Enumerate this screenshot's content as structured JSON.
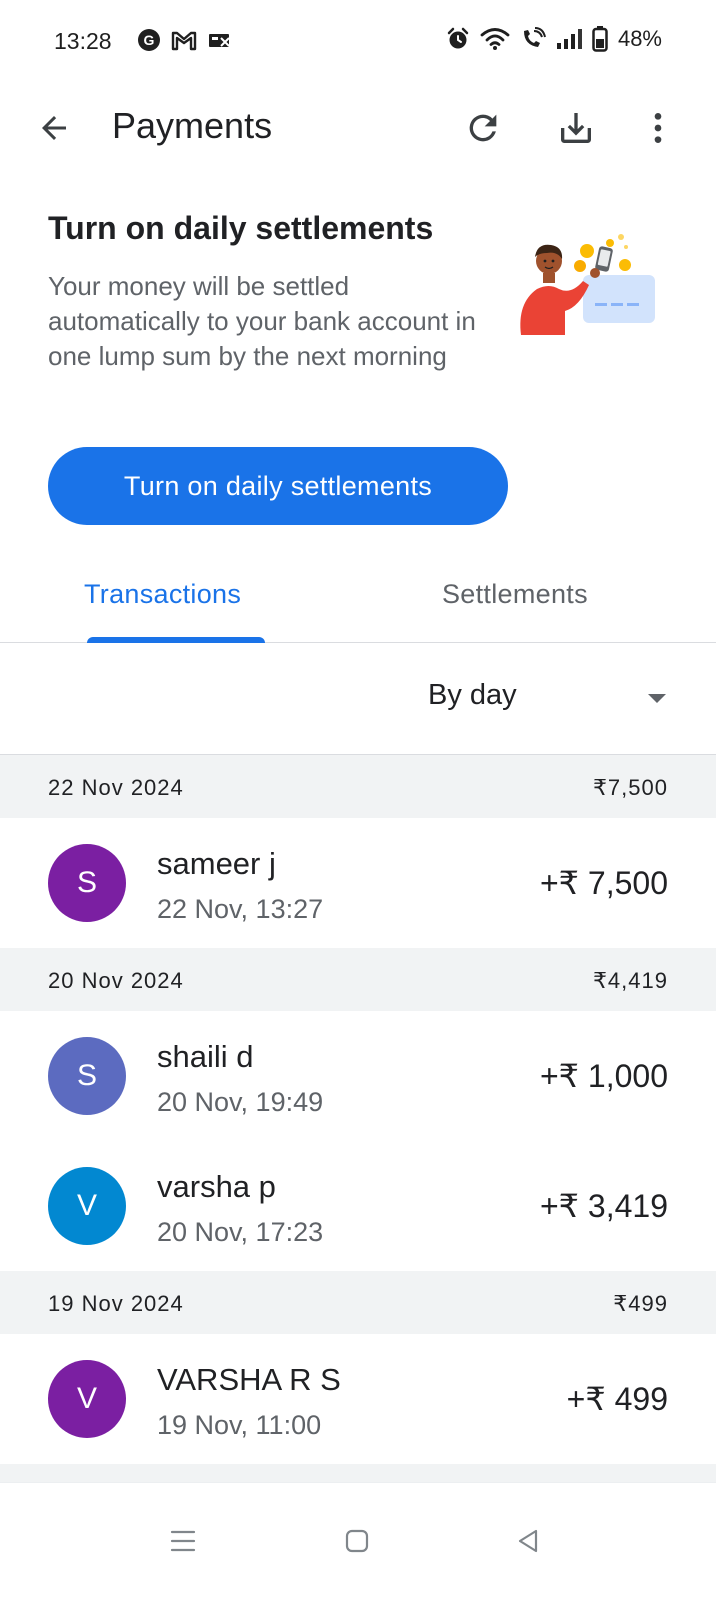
{
  "status_bar": {
    "time": "13:28",
    "app_icons": [
      "google-icon",
      "gmail-icon",
      "payments-icon"
    ],
    "battery": "48%"
  },
  "app_bar": {
    "title": "Payments"
  },
  "promo": {
    "title": "Turn on daily settlements",
    "description": "Your money will be settled automatically to your bank account in one lump sum by the next morning",
    "button_label": "Turn on daily settlements"
  },
  "tabs": [
    {
      "label": "Transactions",
      "active": true
    },
    {
      "label": "Settlements",
      "active": false
    }
  ],
  "filter": {
    "selected": "By day"
  },
  "groups": [
    {
      "date": "22 Nov 2024",
      "total": "₹7,500",
      "items": [
        {
          "initial": "S",
          "name": "sameer j",
          "time": "22 Nov, 13:27",
          "amount": "+₹ 7,500",
          "color": "#7b1fa2"
        }
      ]
    },
    {
      "date": "20 Nov 2024",
      "total": "₹4,419",
      "items": [
        {
          "initial": "S",
          "name": "shaili d",
          "time": "20 Nov, 19:49",
          "amount": "+₹ 1,000",
          "color": "#5c6bc0"
        },
        {
          "initial": "V",
          "name": "varsha p",
          "time": "20 Nov, 17:23",
          "amount": "+₹ 3,419",
          "color": "#0288d1"
        }
      ]
    },
    {
      "date": "19 Nov 2024",
      "total": "₹499",
      "items": [
        {
          "initial": "V",
          "name": "VARSHA R S",
          "time": "19 Nov, 11:00",
          "amount": "+₹ 499",
          "color": "#7b1fa2"
        }
      ]
    }
  ],
  "colors": {
    "accent": "#1a73e8",
    "header_bg": "#f1f3f4",
    "secondary_text": "#5f6368"
  }
}
